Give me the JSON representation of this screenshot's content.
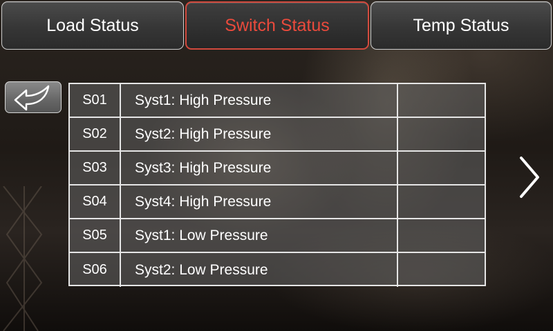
{
  "tabs": [
    {
      "label": "Load Status",
      "active": false
    },
    {
      "label": "Switch Status",
      "active": true
    },
    {
      "label": "Temp Status",
      "active": false
    }
  ],
  "back_icon": "back-arrow-icon",
  "next_icon": "chevron-right-icon",
  "colors": {
    "active_tab_text": "#ea4a3c",
    "active_tab_border": "#d2493d",
    "table_border": "#e6e6e6"
  },
  "table": {
    "rows": [
      {
        "code": "S01",
        "description": "Syst1: High Pressure",
        "state": ""
      },
      {
        "code": "S02",
        "description": "Syst2: High Pressure",
        "state": ""
      },
      {
        "code": "S03",
        "description": "Syst3: High Pressure",
        "state": ""
      },
      {
        "code": "S04",
        "description": "Syst4: High Pressure",
        "state": ""
      },
      {
        "code": "S05",
        "description": "Syst1: Low Pressure",
        "state": ""
      },
      {
        "code": "S06",
        "description": "Syst2: Low Pressure",
        "state": ""
      }
    ]
  }
}
